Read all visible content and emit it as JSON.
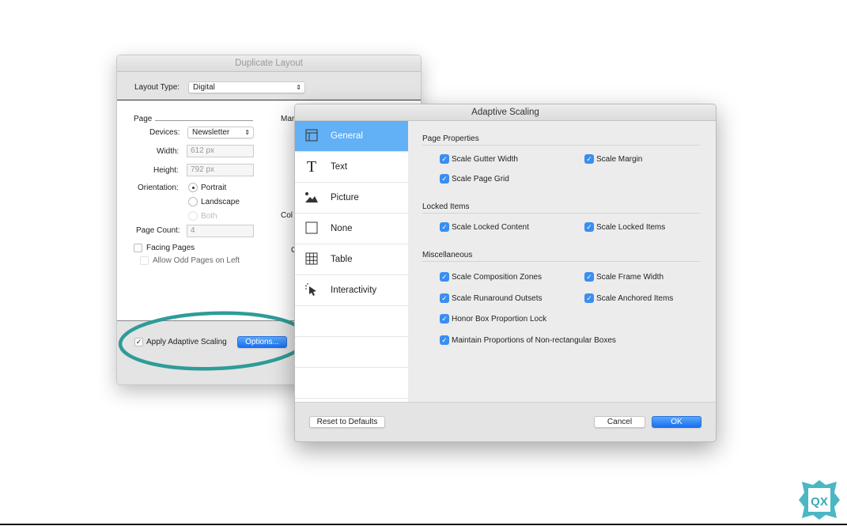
{
  "duplicate_layout": {
    "title": "Duplicate Layout",
    "layout_type_label": "Layout Type:",
    "layout_type_value": "Digital",
    "page_section": "Page",
    "devices_label": "Devices:",
    "devices_value": "Newsletter",
    "width_label": "Width:",
    "width_value": "612 px",
    "height_label": "Height:",
    "height_value": "792 px",
    "orientation_label": "Orientation:",
    "orientation_options": [
      "Portrait",
      "Landscape",
      "Both"
    ],
    "orientation_selected": "Portrait",
    "page_count_label": "Page Count:",
    "page_count_value": "4",
    "facing_pages": "Facing Pages",
    "allow_odd": "Allow Odd Pages on Left",
    "partial_labels": [
      "Mar",
      "Col",
      "G"
    ],
    "apply_adaptive": "Apply Adaptive Scaling",
    "apply_adaptive_checked": true,
    "options_button": "Options..."
  },
  "adaptive_scaling": {
    "title": "Adaptive Scaling",
    "sidebar": [
      {
        "label": "General",
        "icon": "layout-icon",
        "selected": true
      },
      {
        "label": "Text",
        "icon": "text-icon"
      },
      {
        "label": "Picture",
        "icon": "picture-icon"
      },
      {
        "label": "None",
        "icon": "empty-box-icon"
      },
      {
        "label": "Table",
        "icon": "table-icon"
      },
      {
        "label": "Interactivity",
        "icon": "cursor-icon"
      }
    ],
    "sections": {
      "page_properties": "Page Properties",
      "locked_items": "Locked Items",
      "miscellaneous": "Miscellaneous"
    },
    "options": {
      "scale_gutter_width": "Scale Gutter Width",
      "scale_margin": "Scale Margin",
      "scale_page_grid": "Scale Page Grid",
      "scale_locked_content": "Scale Locked Content",
      "scale_locked_items": "Scale Locked Items",
      "scale_composition_zones": "Scale Composition Zones",
      "scale_frame_width": "Scale Frame Width",
      "scale_runaround_outsets": "Scale Runaround Outsets",
      "scale_anchored_items": "Scale Anchored Items",
      "honor_box_proportion": "Honor Box Proportion Lock",
      "maintain_proportions": "Maintain Proportions of Non-rectangular Boxes"
    },
    "reset_button": "Reset to Defaults",
    "cancel_button": "Cancel",
    "ok_button": "OK"
  },
  "logo": {
    "text": "QX"
  },
  "colors": {
    "accent": "#1a6ff0",
    "highlight_ring": "#2e9c98",
    "selected": "#62b0f5"
  }
}
